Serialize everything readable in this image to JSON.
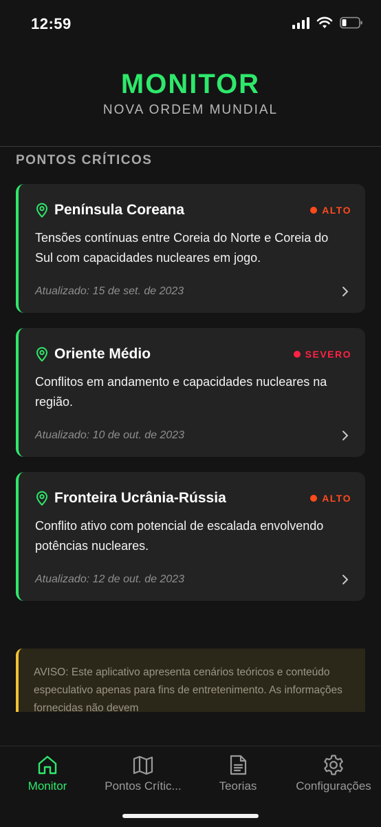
{
  "status_bar": {
    "time": "12:59"
  },
  "header": {
    "title": "MONITOR",
    "subtitle": "NOVA ORDEM MUNDIAL"
  },
  "section": {
    "title": "PONTOS CRÍTICOS"
  },
  "cards": [
    {
      "title": "Península Coreana",
      "severity": "ALTO",
      "severity_color": "#ff4a1c",
      "description": "Tensões contínuas entre Coreia do Norte e Coreia do Sul com capacidades nucleares em jogo.",
      "updated": "Atualizado: 15 de set. de 2023"
    },
    {
      "title": "Oriente Médio",
      "severity": "SEVERO",
      "severity_color": "#ff2244",
      "description": "Conflitos em andamento e capacidades nucleares na região.",
      "updated": "Atualizado: 10 de out. de 2023"
    },
    {
      "title": "Fronteira Ucrânia-Rússia",
      "severity": "ALTO",
      "severity_color": "#ff4a1c",
      "description": "Conflito ativo com potencial de escalada envolvendo potências nucleares.",
      "updated": "Atualizado: 12 de out. de 2023"
    }
  ],
  "disclaimer": {
    "text": "AVISO: Este aplicativo apresenta cenários teóricos e conteúdo especulativo apenas para fins de entretenimento. As informações fornecidas não devem"
  },
  "tab_bar": {
    "tabs": [
      {
        "label": "Monitor",
        "icon": "home-icon",
        "active": true
      },
      {
        "label": "Pontos Crític...",
        "icon": "map-icon",
        "active": false
      },
      {
        "label": "Teorias",
        "icon": "document-icon",
        "active": false
      },
      {
        "label": "Configurações",
        "icon": "gear-icon",
        "active": false
      }
    ]
  },
  "colors": {
    "accent": "#2ee86b",
    "background": "#141414",
    "card": "#232323",
    "warning_border": "#f0c234"
  }
}
